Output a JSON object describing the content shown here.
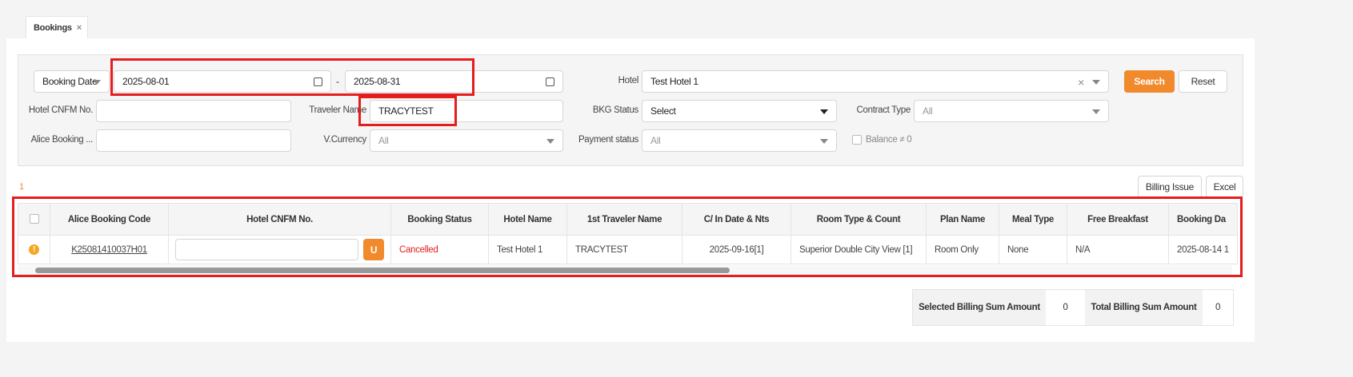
{
  "tab": {
    "label": "Bookings",
    "close": "×"
  },
  "filters": {
    "date_type": "Booking Date",
    "date_from": "2025-08-01",
    "date_sep": "-",
    "date_to": "2025-08-31",
    "hotel_label": "Hotel",
    "hotel_value": "Test Hotel 1",
    "hotel_clear": "×",
    "hotel_cnfm_label": "Hotel CNFM No.",
    "hotel_cnfm_value": "",
    "traveler_label": "Traveler Name",
    "traveler_value": "TRACYTEST",
    "bkg_status_label": "BKG Status",
    "bkg_status_value": "Select",
    "contract_type_label": "Contract Type",
    "contract_type_value": "All",
    "alice_booking_label": "Alice Booking ...",
    "alice_booking_value": "",
    "vcurrency_label": "V.Currency",
    "vcurrency_value": "All",
    "payment_status_label": "Payment status",
    "payment_status_value": "All",
    "balance_label": "Balance ≠ 0",
    "search": "Search",
    "reset": "Reset"
  },
  "result_count": "1",
  "actions": {
    "billing_issue": "Billing Issue",
    "excel": "Excel"
  },
  "table": {
    "headers": [
      "Alice Booking Code",
      "Hotel CNFM No.",
      "Booking Status",
      "Hotel Name",
      "1st Traveler Name",
      "C/ In Date & Nts",
      "Room Type & Count",
      "Plan Name",
      "Meal Type",
      "Free Breakfast",
      "Booking Da"
    ],
    "rows": [
      {
        "code": "K25081410037H01",
        "cnfm": "",
        "u": "U",
        "status": "Cancelled",
        "hotel": "Test Hotel 1",
        "traveler": "TRACYTEST",
        "checkin": "2025-09-16[1]",
        "room": "Superior Double City View [1]",
        "plan": "Room Only",
        "meal": "None",
        "breakfast": "N/A",
        "booking_date": "2025-08-14 1"
      }
    ]
  },
  "summary": {
    "selected_label": "Selected Billing Sum Amount",
    "selected_value": "0",
    "total_label": "Total Billing Sum Amount",
    "total_value": "0"
  },
  "colors": {
    "accent": "#f08a2c",
    "highlight": "#e41d1d",
    "cancelled": "#e41d1d"
  }
}
